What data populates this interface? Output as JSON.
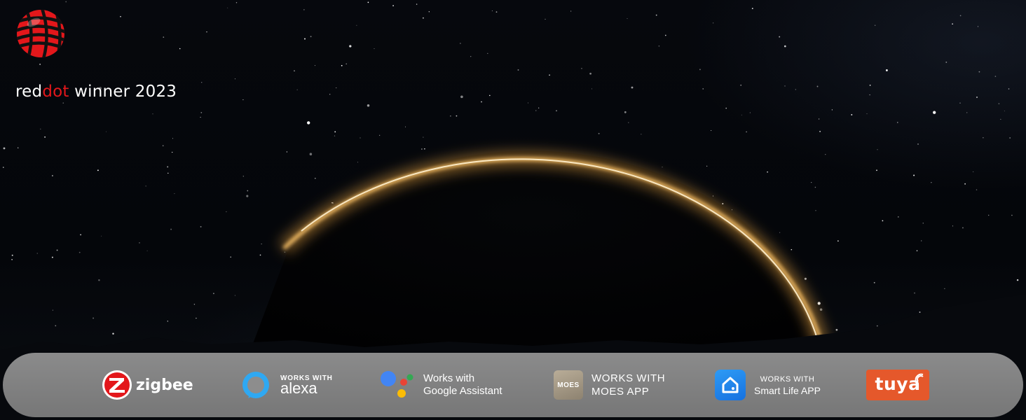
{
  "award": {
    "prefix": "red",
    "highlight": "dot",
    "suffix": " winner 2023",
    "icon": "reddot-award-logo",
    "accent_color": "#e3171b"
  },
  "hero": {
    "background": "starry night sky with glowing planet horizon",
    "glow_color": "#f5a623"
  },
  "badges": {
    "zigbee": {
      "label": "zigbee",
      "icon": "zigbee-logo-icon",
      "color": "#e3171b"
    },
    "alexa": {
      "line1": "WORKS WITH",
      "line2": "alexa",
      "icon": "alexa-ring-icon",
      "color": "#2fa8f2"
    },
    "google": {
      "line1": "Works with",
      "line2": "Google Assistant",
      "icon": "google-assistant-dots-icon"
    },
    "moes": {
      "tile_label": "MOES",
      "line1": "WORKS WITH",
      "line2": "MOES APP",
      "icon": "moes-app-icon"
    },
    "smart_life": {
      "line1": "WORKS WITH",
      "line2": "Smart Life APP",
      "icon": "smart-life-home-icon",
      "color": "#1f86ee"
    },
    "tuya": {
      "label": "tuya",
      "icon": "tuya-logo-icon",
      "color": "#e5582b"
    }
  }
}
